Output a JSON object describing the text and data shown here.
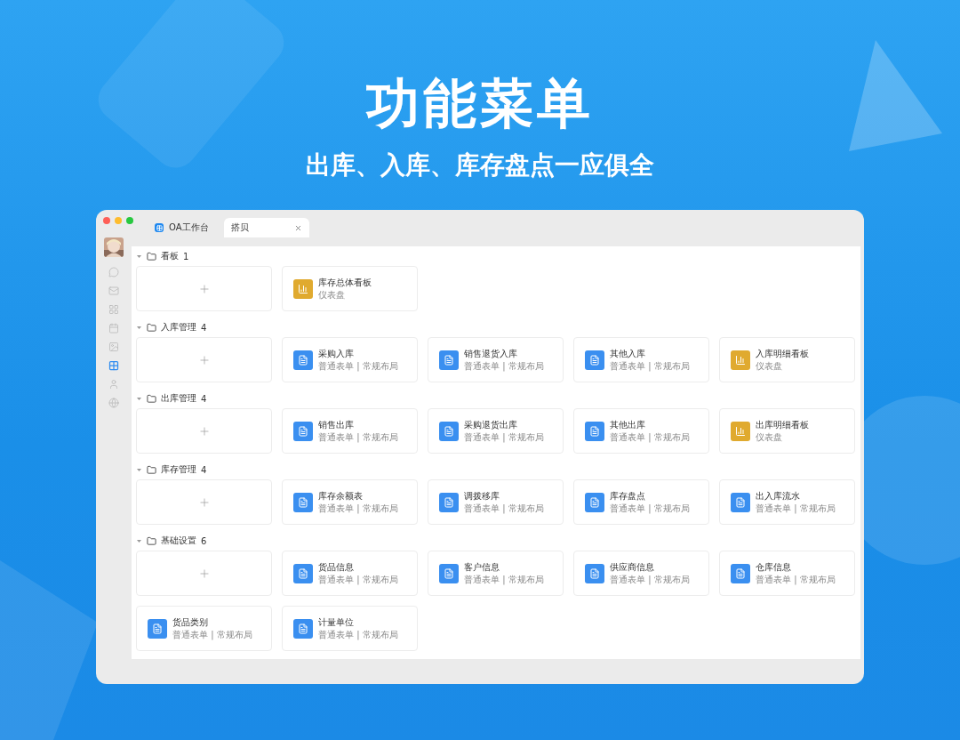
{
  "headline": "功能菜单",
  "subheadline": "出库、入库、库存盘点一应俱全",
  "window": {
    "tabs": [
      {
        "label": "OA工作台",
        "selected": false,
        "closable": false
      },
      {
        "label": "搭贝",
        "selected": true,
        "closable": true
      }
    ]
  },
  "sidebar": {
    "items": [
      {
        "selected": false
      },
      {
        "selected": false
      },
      {
        "selected": false
      },
      {
        "selected": false
      },
      {
        "selected": false
      },
      {
        "selected": true
      },
      {
        "selected": false
      },
      {
        "selected": false
      }
    ]
  },
  "sections": [
    {
      "name": "看板",
      "count": "1",
      "expanded": true,
      "items": [
        {
          "kind": "dashboard",
          "title": "库存总体看板",
          "subtitle": "仪表盘"
        }
      ]
    },
    {
      "name": "入库管理",
      "count": "4",
      "expanded": true,
      "items": [
        {
          "kind": "form",
          "title": "采购入库",
          "subtitle": "普通表单 | 常规布局"
        },
        {
          "kind": "form",
          "title": "销售退货入库",
          "subtitle": "普通表单 | 常规布局"
        },
        {
          "kind": "form",
          "title": "其他入库",
          "subtitle": "普通表单 | 常规布局"
        },
        {
          "kind": "dashboard",
          "title": "入库明细看板",
          "subtitle": "仪表盘"
        }
      ]
    },
    {
      "name": "出库管理",
      "count": "4",
      "expanded": true,
      "items": [
        {
          "kind": "form",
          "title": "销售出库",
          "subtitle": "普通表单 | 常规布局"
        },
        {
          "kind": "form",
          "title": "采购退货出库",
          "subtitle": "普通表单 | 常规布局"
        },
        {
          "kind": "form",
          "title": "其他出库",
          "subtitle": "普通表单 | 常规布局"
        },
        {
          "kind": "dashboard",
          "title": "出库明细看板",
          "subtitle": "仪表盘"
        }
      ]
    },
    {
      "name": "库存管理",
      "count": "4",
      "expanded": true,
      "items": [
        {
          "kind": "form",
          "title": "库存余额表",
          "subtitle": "普通表单 | 常规布局"
        },
        {
          "kind": "form",
          "title": "调拨移库",
          "subtitle": "普通表单 | 常规布局"
        },
        {
          "kind": "form",
          "title": "库存盘点",
          "subtitle": "普通表单 | 常规布局"
        },
        {
          "kind": "form",
          "title": "出入库流水",
          "subtitle": "普通表单 | 常规布局"
        }
      ]
    },
    {
      "name": "基础设置",
      "count": "6",
      "expanded": true,
      "items": [
        {
          "kind": "form",
          "title": "货品信息",
          "subtitle": "普通表单 | 常规布局"
        },
        {
          "kind": "form",
          "title": "客户信息",
          "subtitle": "普通表单 | 常规布局"
        },
        {
          "kind": "form",
          "title": "供应商信息",
          "subtitle": "普通表单 | 常规布局"
        },
        {
          "kind": "form",
          "title": "仓库信息",
          "subtitle": "普通表单 | 常规布局"
        },
        {
          "kind": "form",
          "title": "货品类别",
          "subtitle": "普通表单 | 常规布局"
        },
        {
          "kind": "form",
          "title": "计量单位",
          "subtitle": "普通表单 | 常规布局"
        }
      ]
    }
  ]
}
